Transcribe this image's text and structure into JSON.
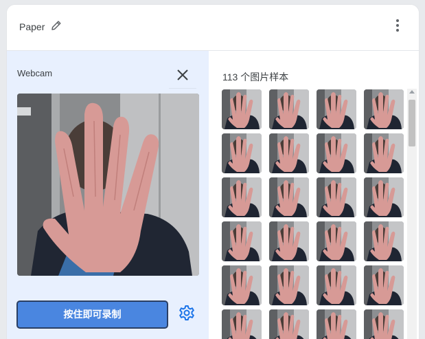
{
  "header": {
    "title": "Paper",
    "edit_icon": "pencil-icon",
    "menu_icon": "more-vert-icon"
  },
  "webcam": {
    "label": "Webcam",
    "close_icon": "close-icon",
    "record_button_label": "按住即可录制",
    "settings_icon": "gear-icon",
    "accent_color": "#4a86e0"
  },
  "samples": {
    "count_label": "113 个图片样本"
  }
}
